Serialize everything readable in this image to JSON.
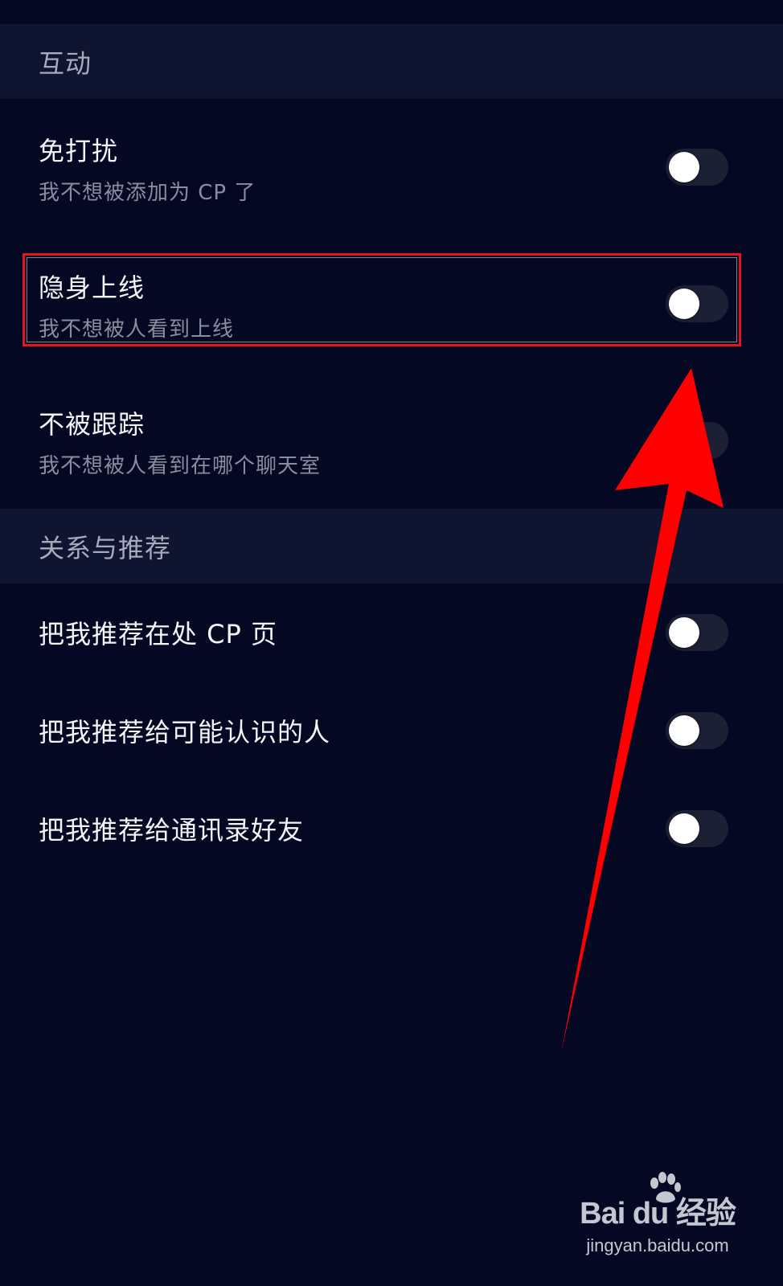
{
  "sections": [
    {
      "header": "互动",
      "items": [
        {
          "title": "免打扰",
          "subtitle": "我不想被添加为 CP 了",
          "toggle_on": false
        },
        {
          "title": "隐身上线",
          "subtitle": "我不想被人看到上线",
          "toggle_on": false
        },
        {
          "title": "不被跟踪",
          "subtitle": "我不想被人看到在哪个聊天室",
          "toggle_on": false
        }
      ]
    },
    {
      "header": "关系与推荐",
      "items": [
        {
          "title": "把我推荐在处 CP 页",
          "toggle_on": false
        },
        {
          "title": "把我推荐给可能认识的人",
          "toggle_on": false
        },
        {
          "title": "把我推荐给通讯录好友",
          "toggle_on": false
        }
      ]
    }
  ],
  "annotation": {
    "highlight_color": "#e8141c",
    "arrow_color": "#ff0000",
    "target": "隐身上线"
  },
  "watermark": {
    "logo_text": "Bai du 经验",
    "url": "jingyan.baidu.com"
  },
  "colors": {
    "background": "#040823",
    "section_header_bg": "#0f1430",
    "toggle_track": "#1b2034",
    "toggle_knob": "#ffffff"
  }
}
